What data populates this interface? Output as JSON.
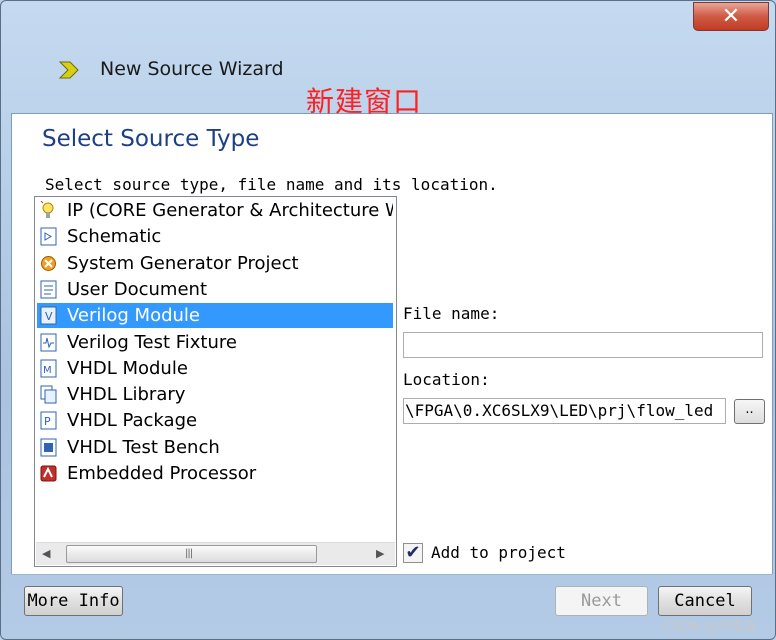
{
  "window": {
    "title": "New Source Wizard",
    "close_label": "✕",
    "annotation": "新建窗口"
  },
  "page": {
    "heading": "Select Source Type",
    "instruction": "Select source type, file name and its location."
  },
  "source_types": [
    {
      "label": "IP (CORE Generator & Architecture Wizard)",
      "icon": "ip-core-icon",
      "selected": false
    },
    {
      "label": "Schematic",
      "icon": "schematic-icon",
      "selected": false
    },
    {
      "label": "System Generator Project",
      "icon": "system-generator-icon",
      "selected": false
    },
    {
      "label": "User Document",
      "icon": "user-document-icon",
      "selected": false
    },
    {
      "label": "Verilog Module",
      "icon": "verilog-module-icon",
      "selected": true
    },
    {
      "label": "Verilog Test Fixture",
      "icon": "verilog-test-fixture-icon",
      "selected": false
    },
    {
      "label": "VHDL Module",
      "icon": "vhdl-module-icon",
      "selected": false
    },
    {
      "label": "VHDL Library",
      "icon": "vhdl-library-icon",
      "selected": false
    },
    {
      "label": "VHDL Package",
      "icon": "vhdl-package-icon",
      "selected": false
    },
    {
      "label": "VHDL Test Bench",
      "icon": "vhdl-test-bench-icon",
      "selected": false
    },
    {
      "label": "Embedded Processor",
      "icon": "embedded-processor-icon",
      "selected": false
    }
  ],
  "scrollbar": {
    "left": "◀",
    "right": "▶",
    "grip": "|||"
  },
  "form": {
    "file_name_label": "File name:",
    "file_name_value": "",
    "location_label": "Location:",
    "location_value": "\\FPGA\\0.XC6SLX9\\LED\\prj\\flow_led",
    "browse_label": "..",
    "add_to_project_label": "Add to project",
    "add_to_project_checked": true
  },
  "buttons": {
    "more_info": "More Info",
    "next": "Next",
    "cancel": "Cancel"
  },
  "watermark": "CSDN @仲南音",
  "colors": {
    "selection": "#3399ff",
    "heading": "#1e3f86",
    "annotation": "#ff2020"
  }
}
